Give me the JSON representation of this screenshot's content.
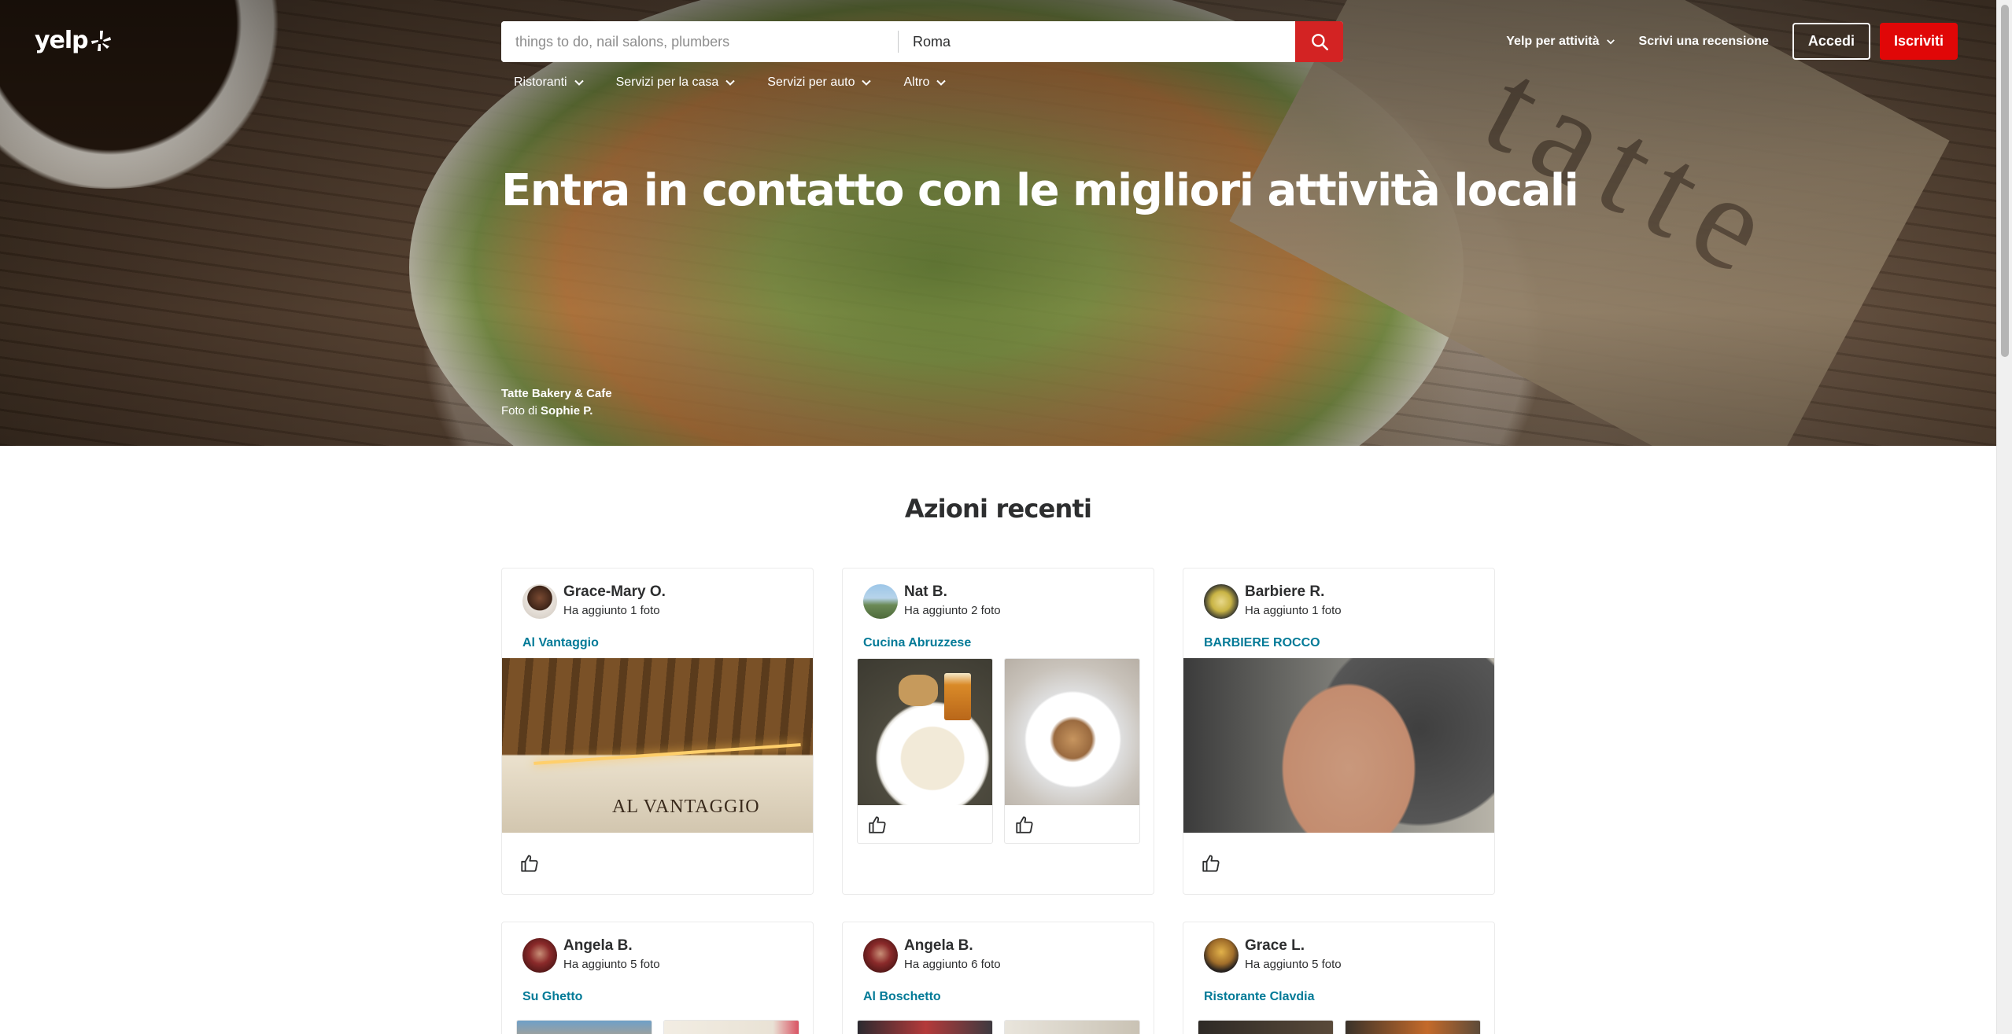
{
  "header": {
    "logo_text": "yelp",
    "search": {
      "find_placeholder": "things to do, nail salons, plumbers",
      "near_value": "Roma"
    },
    "categories": [
      {
        "label": "Ristoranti"
      },
      {
        "label": "Servizi per la casa"
      },
      {
        "label": "Servizi per auto"
      },
      {
        "label": "Altro"
      }
    ],
    "nav": {
      "business": "Yelp per attività",
      "write_review": "Scrivi una recensione",
      "login": "Accedi",
      "signup": "Iscriviti"
    }
  },
  "hero": {
    "headline": "Entra in contatto con le migliori attività locali",
    "photo_business": "Tatte Bakery & Cafe",
    "photo_by_prefix": "Foto di",
    "photo_author": "Sophie P.",
    "decor_text": "tatte"
  },
  "recent": {
    "title": "Azioni recenti",
    "cards": [
      {
        "user": "Grace-Mary O.",
        "action": "Ha aggiunto 1 foto",
        "business": "Al Vantaggio",
        "photo_sign": "AL VANTAGGIO"
      },
      {
        "user": "Nat B.",
        "action": "Ha aggiunto 2 foto",
        "business": "Cucina Abruzzese"
      },
      {
        "user": "Barbiere R.",
        "action": "Ha aggiunto 1 foto",
        "business": "BARBIERE ROCCO"
      },
      {
        "user": "Angela B.",
        "action": "Ha aggiunto 5 foto",
        "business": "Su Ghetto"
      },
      {
        "user": "Angela B.",
        "action": "Ha aggiunto 6 foto",
        "business": "Al Boschetto"
      },
      {
        "user": "Grace L.",
        "action": "Ha aggiunto 5 foto",
        "business": "Ristorante Clavdia"
      }
    ]
  },
  "colors": {
    "brand_red": "#d32323",
    "signup_red": "#e00707",
    "link_teal": "#027a97"
  }
}
